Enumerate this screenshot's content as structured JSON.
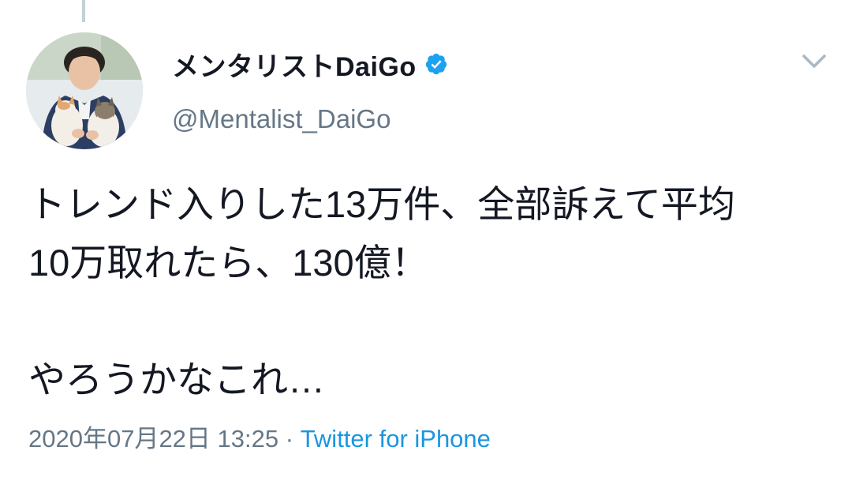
{
  "author": {
    "display_name": "メンタリストDaiGo",
    "handle": "@Mentalist_DaiGo",
    "verified": true,
    "avatar": "profile-photo-man-with-cats"
  },
  "tweet": {
    "lines": [
      "トレンド入りした13万件、全部訴えて平均",
      "10万取れたら、130億！",
      "",
      "やろうかなこれ…"
    ],
    "timestamp": "2020年07月22日 13:25",
    "separator": " · ",
    "source": "Twitter for iPhone"
  },
  "colors": {
    "text": "#141823",
    "secondary": "#657786",
    "link": "#1b95e0",
    "verified": "#1da1f2"
  },
  "icons": {
    "menu": "chevron-down-icon",
    "badge": "verified-badge-icon"
  }
}
